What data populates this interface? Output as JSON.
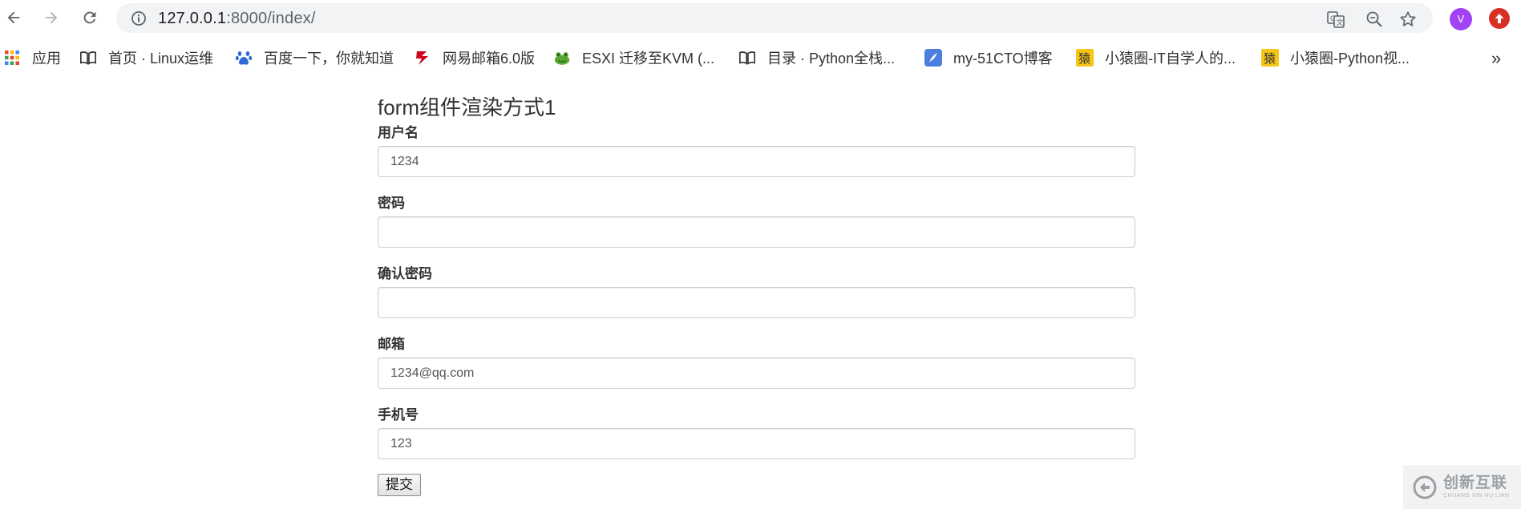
{
  "browser": {
    "url_host": "127.0.0.1",
    "url_rest": ":8000/index/",
    "avatar_letter": "V",
    "colors": {
      "avatar": "#a142f4",
      "update": "#d93025",
      "omnibox": "#f1f3f4"
    }
  },
  "bookmarks": [
    {
      "label": "应用",
      "icon": "apps-grid-icon"
    },
    {
      "label": "首页 · Linux运维",
      "icon": "book-icon"
    },
    {
      "label": "百度一下，你就知道",
      "icon": "baidu-paw-icon"
    },
    {
      "label": "网易邮箱6.0版",
      "icon": "netease-mail-icon"
    },
    {
      "label": "ESXI 迁移至KVM (...",
      "icon": "frog-icon"
    },
    {
      "label": "目录 · Python全栈...",
      "icon": "book-icon"
    },
    {
      "label": "my-51CTO博客",
      "icon": "feather-icon"
    },
    {
      "label": "小猿圈-IT自学人的...",
      "icon": "yuan-icon"
    },
    {
      "label": "小猿圈-Python视...",
      "icon": "yuan-icon"
    }
  ],
  "bookmarks_more": "»",
  "form": {
    "title": "form组件渲染方式1",
    "fields": [
      {
        "label": "用户名",
        "value": "1234"
      },
      {
        "label": "密码",
        "value": ""
      },
      {
        "label": "确认密码",
        "value": ""
      },
      {
        "label": "邮箱",
        "value": "1234@qq.com"
      },
      {
        "label": "手机号",
        "value": "123"
      }
    ],
    "submit_label": "提交"
  },
  "watermark": {
    "cn": "创新互联",
    "en": "CHUANG XIN HU LIAN"
  }
}
